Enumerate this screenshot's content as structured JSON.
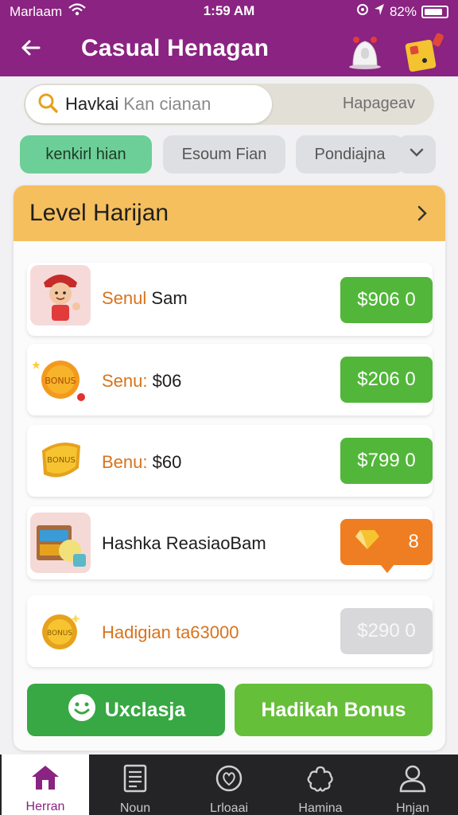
{
  "status_bar": {
    "carrier": "Marlaam",
    "time": "1:59 AM",
    "battery": "82%"
  },
  "app_bar": {
    "title": "Casual Henagan"
  },
  "search": {
    "bold_text": "Havkai",
    "placeholder": "Kan cianan",
    "right_text": "Hapageav"
  },
  "chips": [
    {
      "label": "kenkirl hian",
      "active": true
    },
    {
      "label": "Esoum Fian",
      "active": false
    },
    {
      "label": "Pondiajna",
      "active": false
    }
  ],
  "card": {
    "title": "Level Harijan",
    "rows": [
      {
        "label_orange": "Senul",
        "label_dark": "Sam",
        "price": "$906 0",
        "price_style": "green",
        "icon": "chef-avatar-icon"
      },
      {
        "label_orange": "Senu:",
        "label_dark": "$06",
        "price": "$206 0",
        "price_style": "green",
        "icon": "bonus-coin-icon"
      },
      {
        "label_orange": "Benu:",
        "label_dark": "$60",
        "price": "$799 0",
        "price_style": "green",
        "icon": "gold-badge-icon"
      },
      {
        "label_orange": "",
        "label_dark": "Hashka ReasiaoBam",
        "price": "8",
        "price_style": "orange",
        "icon": "treasure-box-icon"
      },
      {
        "label_orange": "Hadigian ta63000",
        "label_dark": "",
        "price": "$290 0",
        "price_style": "grey",
        "icon": "coin-icon"
      }
    ]
  },
  "buttons": {
    "left_label": "Uxclasja",
    "right_label": "Hadikah Bonus"
  },
  "tabbar": [
    {
      "label": "Herran",
      "icon": "home-icon",
      "active": true
    },
    {
      "label": "Noun",
      "icon": "document-icon",
      "active": false
    },
    {
      "label": "Lrloaai",
      "icon": "heart-circle-icon",
      "active": false
    },
    {
      "label": "Hamina",
      "icon": "flower-icon",
      "active": false
    },
    {
      "label": "Hnjan",
      "icon": "profile-icon",
      "active": false
    }
  ],
  "colors": {
    "brand": "#8a2381",
    "header": "#f5bf5e",
    "green": "#52b63a",
    "orange": "#ef7e22"
  }
}
